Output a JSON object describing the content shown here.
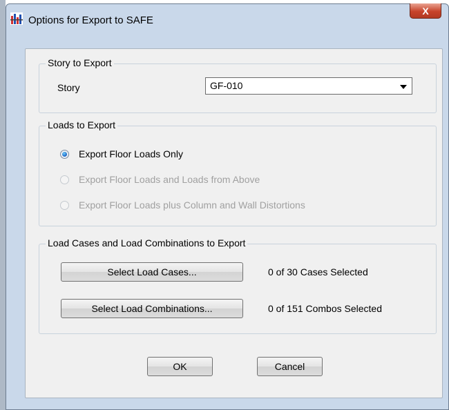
{
  "window": {
    "title": "Options for Export to SAFE",
    "close_glyph": "X",
    "icon": "etabs-app-icon"
  },
  "story_group": {
    "legend": "Story to Export",
    "story_label": "Story",
    "story_value": "GF-010"
  },
  "loads_group": {
    "legend": "Loads to Export",
    "options": [
      {
        "label": "Export Floor Loads Only",
        "selected": true,
        "enabled": true
      },
      {
        "label": "Export Floor Loads and Loads from Above",
        "selected": false,
        "enabled": false
      },
      {
        "label": "Export Floor Loads plus Column and Wall Distortions",
        "selected": false,
        "enabled": false
      }
    ]
  },
  "cases_group": {
    "legend": "Load Cases and Load Combinations to Export",
    "select_cases_label": "Select Load Cases...",
    "cases_status": "0 of 30 Cases Selected",
    "select_combos_label": "Select Load Combinations...",
    "combos_status": "0 of 151 Combos Selected"
  },
  "buttons": {
    "ok": "OK",
    "cancel": "Cancel"
  }
}
